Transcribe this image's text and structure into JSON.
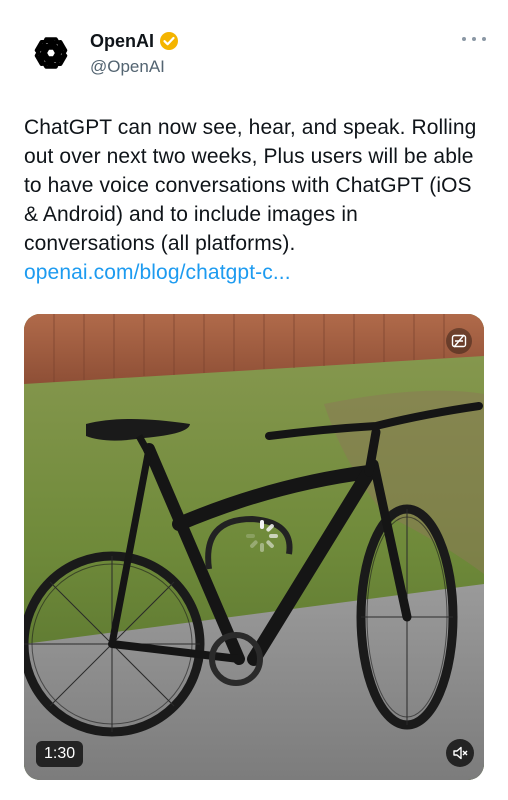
{
  "author": {
    "name": "OpenAI",
    "handle": "@OpenAI",
    "verified_badge_color": "#f4b400"
  },
  "tweet": {
    "text_lines": [
      "ChatGPT can now see, hear, and speak. Rolling",
      "out over next two weeks, Plus users will be able",
      "to have voice conversations with ChatGPT (iOS",
      "& Android) and to include images in",
      "conversations (all platforms)."
    ],
    "link_text": "openai.com/blog/chatgpt-c..."
  },
  "media": {
    "type": "video",
    "duration": "1:30",
    "icons": {
      "mute": "speaker-muted-icon",
      "overlay": "caption-icon"
    }
  },
  "colors": {
    "link": "#1d9bf0",
    "text": "#0f1419",
    "secondary": "#536471"
  }
}
